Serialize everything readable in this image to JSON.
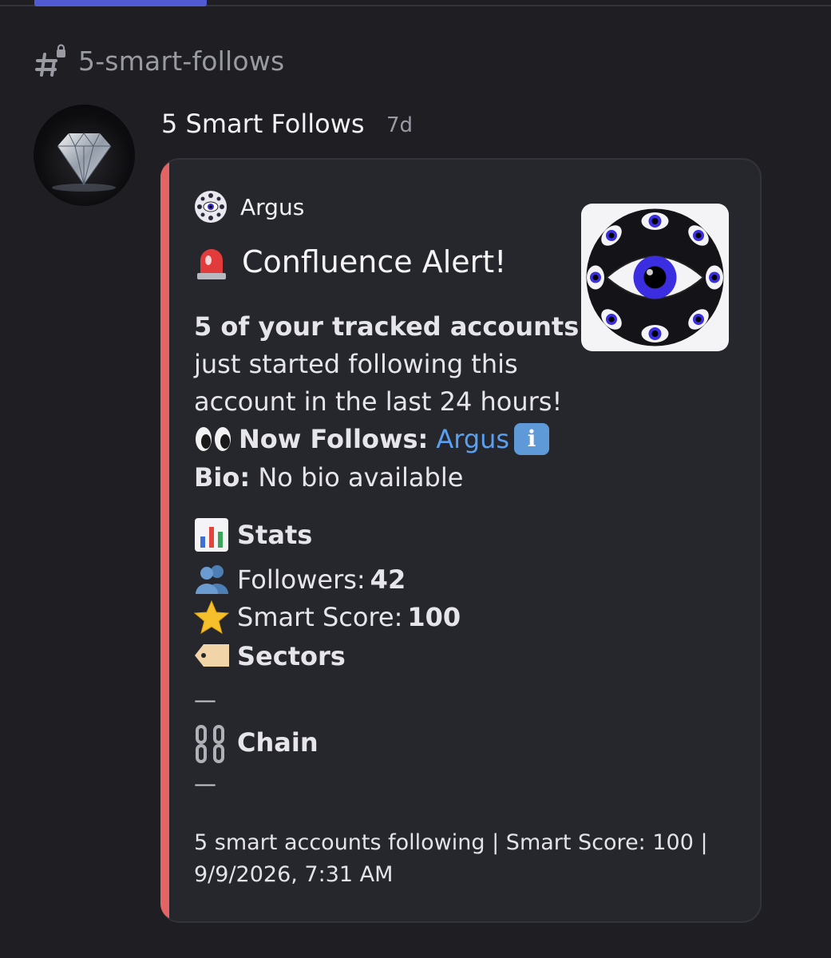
{
  "channel": {
    "name": "5-smart-follows",
    "icon": "hash-lock-icon"
  },
  "message": {
    "username": "5 Smart Follows",
    "timestamp": "7d",
    "avatar": "diamond-avatar"
  },
  "embed": {
    "accent_color": "#e36464",
    "author": {
      "name": "Argus",
      "icon": "eye-orb-icon"
    },
    "thumbnail": "argus-eyes-logo",
    "title": {
      "emoji": "rotating-light-icon",
      "text": "Confluence Alert!"
    },
    "intro": {
      "bold": "5 of your tracked accounts",
      "line2": "just started following this",
      "line3": "account in the last 24 hours!"
    },
    "now_follows": {
      "emoji": "eyes-icon",
      "label": "Now Follows:",
      "link": "Argus",
      "badge": "i"
    },
    "bio": {
      "label": "Bio:",
      "value": "No bio available"
    },
    "stats": {
      "header": "Stats",
      "followers_label": "Followers:",
      "followers_value": "42",
      "smart_score_label": "Smart Score:",
      "smart_score_value": "100"
    },
    "sectors": {
      "header": "Sectors",
      "value": "—"
    },
    "chain": {
      "header": "Chain",
      "value": "—"
    },
    "footer": {
      "line1": "5 smart accounts following | Smart Score: 100 |",
      "line2": "9/9/2026, 7:31 AM"
    }
  }
}
